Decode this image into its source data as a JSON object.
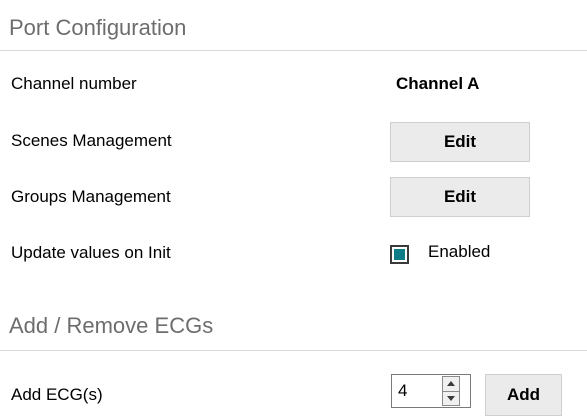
{
  "port_configuration": {
    "title": "Port Configuration",
    "channel_label": "Channel number",
    "channel_value": "Channel A",
    "scenes_label": "Scenes Management",
    "scenes_button": "Edit",
    "groups_label": "Groups Management",
    "groups_button": "Edit",
    "update_label": "Update values on Init",
    "update_checkbox_label": "Enabled",
    "update_checked": true
  },
  "add_remove_ecgs": {
    "title": "Add / Remove ECGs",
    "add_label": "Add ECG(s)",
    "add_count": "4",
    "add_button": "Add"
  },
  "colors": {
    "checkbox_checked": "#0e7c86",
    "section_title": "#6d6d6d",
    "button_bg": "#ebebeb"
  }
}
